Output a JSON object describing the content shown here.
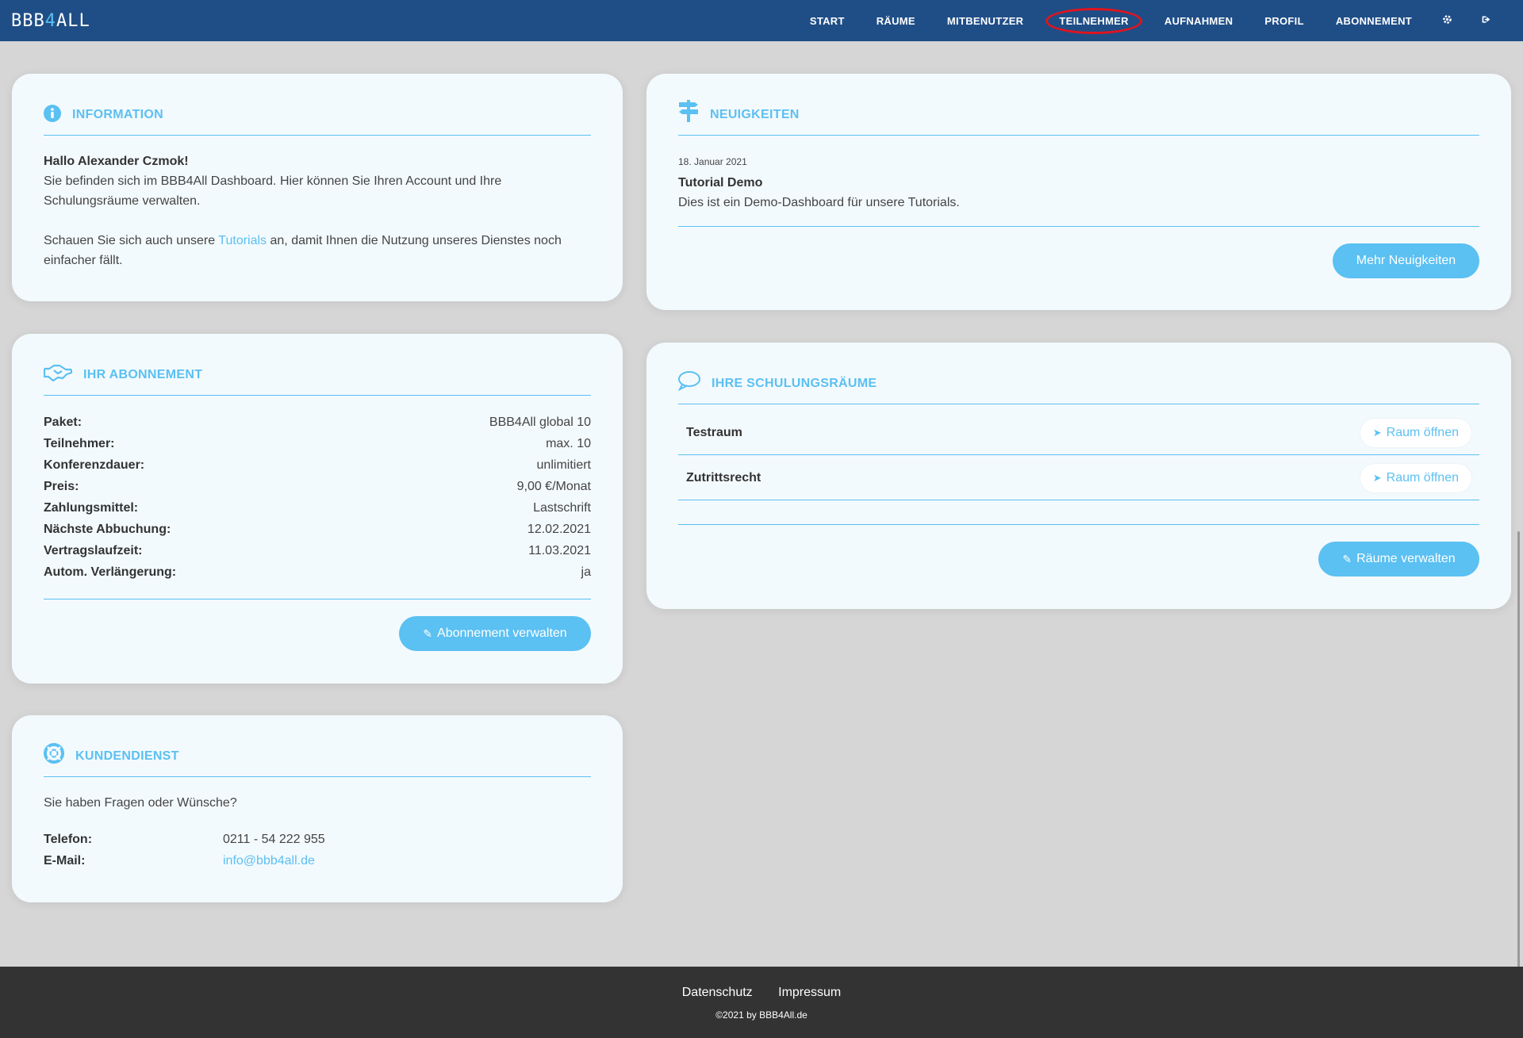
{
  "logo": {
    "pre": "BBB",
    "four": "4",
    "post": "ALL"
  },
  "nav": {
    "items": [
      "START",
      "RÄUME",
      "MITBENUTZER",
      "TEILNEHMER",
      "AUFNAHMEN",
      "PROFIL",
      "ABONNEMENT"
    ],
    "active": "TEILNEHMER",
    "settings_icon": "gear-icon",
    "logout_icon": "logout-icon"
  },
  "information": {
    "title": "INFORMATION",
    "greeting": "Hallo Alexander Czmok!",
    "line1": "Sie befinden sich im BBB4All Dashboard. Hier können Sie Ihren Account und Ihre Schulungsräume verwalten.",
    "line2_pre": "Schauen Sie sich auch unsere ",
    "link": "Tutorials",
    "line2_post": " an, damit Ihnen die Nutzung unseres Dienstes noch einfacher fällt."
  },
  "news": {
    "title": "NEUIGKEITEN",
    "date": "18. Januar 2021",
    "item_title": "Tutorial Demo",
    "item_text": "Dies ist ein Demo-Dashboard für unsere Tutorials.",
    "more_button": "Mehr Neuigkeiten"
  },
  "subscription": {
    "title": "IHR ABONNEMENT",
    "rows": [
      {
        "k": "Paket:",
        "v": "BBB4All global 10"
      },
      {
        "k": "Teilnehmer:",
        "v": "max. 10"
      },
      {
        "k": "Konferenzdauer:",
        "v": "unlimitiert"
      },
      {
        "k": "Preis:",
        "v": "9,00 €/Monat"
      },
      {
        "k": "Zahlungsmittel:",
        "v": "Lastschrift"
      },
      {
        "k": "Nächste Abbuchung:",
        "v": "12.02.2021"
      },
      {
        "k": "Vertragslaufzeit:",
        "v": "11.03.2021"
      },
      {
        "k": "Autom. Verlängerung:",
        "v": "ja"
      }
    ],
    "button": "Abonnement verwalten"
  },
  "rooms": {
    "title": "IHRE SCHULUNGSRÄUME",
    "items": [
      {
        "name": "Testraum",
        "button": "Raum öffnen"
      },
      {
        "name": "Zutrittsrecht",
        "button": "Raum öffnen"
      }
    ],
    "manage_button": "Räume verwalten"
  },
  "support": {
    "title": "KUNDENDIENST",
    "question": "Sie haben Fragen oder Wünsche?",
    "phone_label": "Telefon:",
    "phone": "0211 - 54 222 955",
    "email_label": "E-Mail:",
    "email": "info@bbb4all.de"
  },
  "footer": {
    "links": [
      "Datenschutz",
      "Impressum"
    ],
    "copyright": "©2021 by BBB4All.de"
  },
  "colors": {
    "nav_bg": "#1f4e87",
    "accent": "#5bc0f2",
    "page_bg": "#d6d6d6",
    "card_bg": "#f3fafd",
    "footer_bg": "#333333",
    "active_ring": "#e0141e"
  }
}
